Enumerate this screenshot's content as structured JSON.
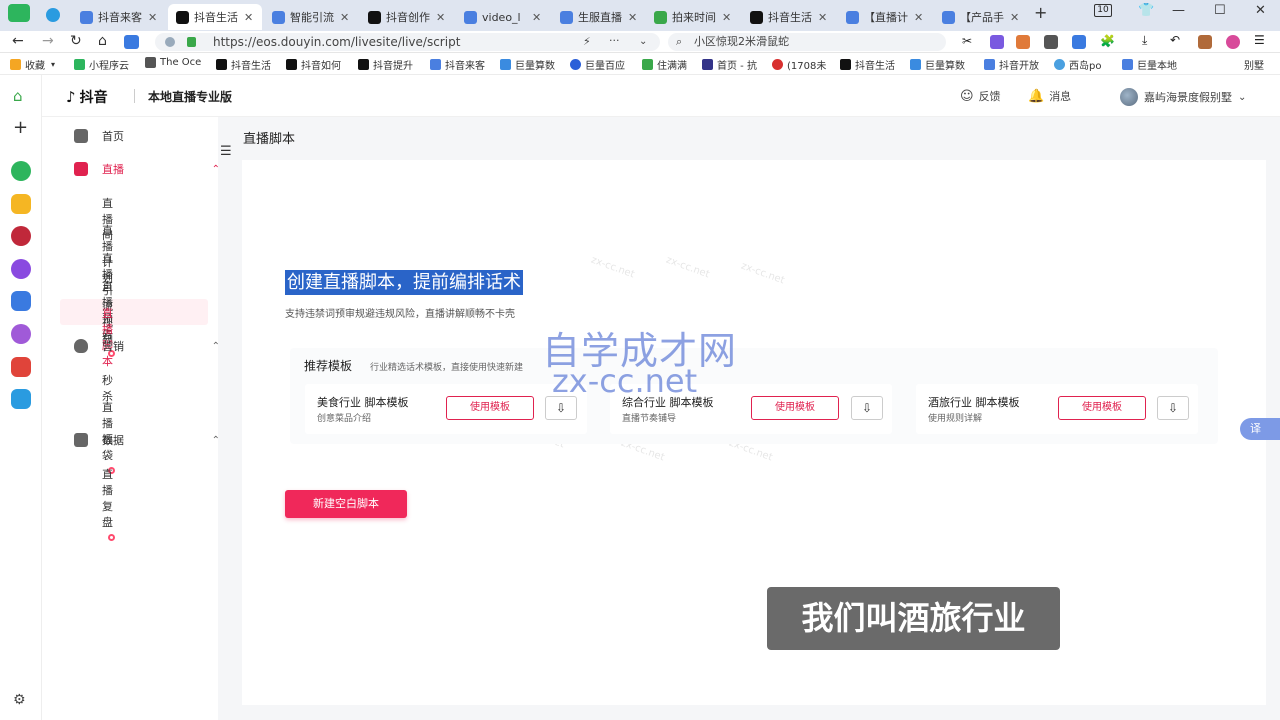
{
  "tabs": [
    {
      "label": "抖音来客",
      "color": "#4a7fe0"
    },
    {
      "label": "抖音生活",
      "color": "#111111"
    },
    {
      "label": "智能引流",
      "color": "#4a7fe0"
    },
    {
      "label": "抖音创作",
      "color": "#111111"
    },
    {
      "label": "video_l",
      "color": "#4a7fe0"
    },
    {
      "label": "生服直播",
      "color": "#4a7fe0"
    },
    {
      "label": "拍来时间",
      "color": "#3aa84a"
    },
    {
      "label": "抖音生活",
      "color": "#111111"
    },
    {
      "label": "【直播计",
      "color": "#4a7fe0"
    },
    {
      "label": "【产品手",
      "color": "#4a7fe0"
    }
  ],
  "tab_count_badge": "10",
  "address": {
    "url": "https://eos.douyin.com/livesite/live/script",
    "search_text": "小区惊现2米滑鼠蛇"
  },
  "bookmarks": [
    {
      "label": "收藏",
      "color": "#f5a623"
    },
    {
      "label": "小程序云",
      "color": "#2db55d"
    },
    {
      "label": "The Oce",
      "color": "#555555"
    },
    {
      "label": "抖音生活",
      "color": "#111111"
    },
    {
      "label": "抖音如何",
      "color": "#111111"
    },
    {
      "label": "抖音提升",
      "color": "#111111"
    },
    {
      "label": "抖音来客",
      "color": "#4a7fe0"
    },
    {
      "label": "巨量算数",
      "color": "#3a8be0"
    },
    {
      "label": "巨量百应",
      "color": "#2b5fd8"
    },
    {
      "label": "住满满",
      "color": "#3aa84a"
    },
    {
      "label": "首页 - 抗",
      "color": "#333388"
    },
    {
      "label": "(1708未",
      "color": "#d8302f"
    },
    {
      "label": "抖音生活",
      "color": "#111111"
    },
    {
      "label": "巨量算数",
      "color": "#3a8be0"
    },
    {
      "label": "抖音开放",
      "color": "#4a7fe0"
    },
    {
      "label": "西岛po",
      "color": "#4aa0e0"
    },
    {
      "label": "巨量本地",
      "color": "#4a7fe0"
    },
    {
      "label": "别墅",
      "color": "#ffffff"
    }
  ],
  "app": {
    "brand": "抖音",
    "product": "本地直播专业版",
    "feedback": "反馈",
    "messages": "消息",
    "account": "嘉屿海景度假别墅"
  },
  "sidebar": {
    "home": "首页",
    "live": "直播",
    "live_items": [
      "直播间",
      "直播计划",
      "直播引流视频",
      "直播预告",
      "直播脚本"
    ],
    "marketing": "营销",
    "marketing_items": [
      "秒杀",
      "直播福袋"
    ],
    "data": "数据",
    "data_items": [
      "直播复盘"
    ]
  },
  "page": {
    "title": "直播脚本",
    "hero": "创建直播脚本，提前编排话术",
    "hero_sub": "支持违禁词预审规避违规风险，直播讲解顺畅不卡壳",
    "templates_title": "推荐模板",
    "templates_desc": "行业精选话术模板，直接使用快速新建",
    "templates": [
      {
        "name": "美食行业 脚本模板",
        "sub": "创意菜品介绍",
        "action": "使用模板"
      },
      {
        "name": "综合行业 脚本模板",
        "sub": "直播节奏铺导",
        "action": "使用模板"
      },
      {
        "name": "酒旅行业 脚本模板",
        "sub": "使用规则详解",
        "action": "使用模板"
      }
    ],
    "new_button": "新建空白脚本"
  },
  "overlay": {
    "watermark_cn": "自学成才网",
    "watermark_url": "zx-cc.net",
    "subtitle": "我们叫酒旅行业",
    "translate": "译"
  }
}
